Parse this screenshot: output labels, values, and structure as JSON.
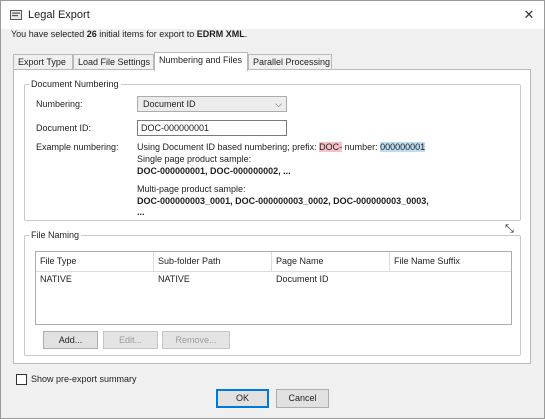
{
  "window": {
    "title": "Legal Export",
    "close_glyph": "✕",
    "icon": "legal-export-app-icon"
  },
  "summary": {
    "prefix": "You have selected ",
    "count": "26",
    "middle": " initial items for export to ",
    "target": "EDRM XML",
    "suffix": "."
  },
  "tabs": [
    {
      "label": "Export Type",
      "active": false
    },
    {
      "label": "Load File Settings",
      "active": false
    },
    {
      "label": "Numbering and Files",
      "active": true
    },
    {
      "label": "Parallel Processing",
      "active": false
    }
  ],
  "document_numbering": {
    "legend": "Document Numbering",
    "numbering_label": "Numbering:",
    "numbering_value": "Document ID",
    "document_id_label": "Document ID:",
    "document_id_value": "DOC-000000001",
    "example_label": "Example numbering:",
    "example_intro": "Using Document ID based numbering; prefix: ",
    "example_prefix": "DOC-",
    "example_number_label": " number: ",
    "example_number": "000000001",
    "single_page_label": "Single page product sample:",
    "single_page_sample": "DOC-000000001, DOC-000000002, ...",
    "multi_page_label": "Multi-page product sample:",
    "multi_page_sample": "DOC-000000003_0001, DOC-000000003_0002, DOC-000000003_0003,",
    "multi_page_sample_cont": "..."
  },
  "file_naming": {
    "legend": "File Naming",
    "columns": [
      "File Type",
      "Sub-folder Path",
      "Page Name",
      "File Name Suffix"
    ],
    "rows": [
      [
        "NATIVE",
        "NATIVE",
        "Document ID",
        ""
      ]
    ],
    "add_label": "Add...",
    "edit_label": "Edit...",
    "remove_label": "Remove..."
  },
  "footer": {
    "show_summary_label": "Show pre-export summary",
    "show_summary_checked": false,
    "ok_label": "OK",
    "cancel_label": "Cancel"
  }
}
